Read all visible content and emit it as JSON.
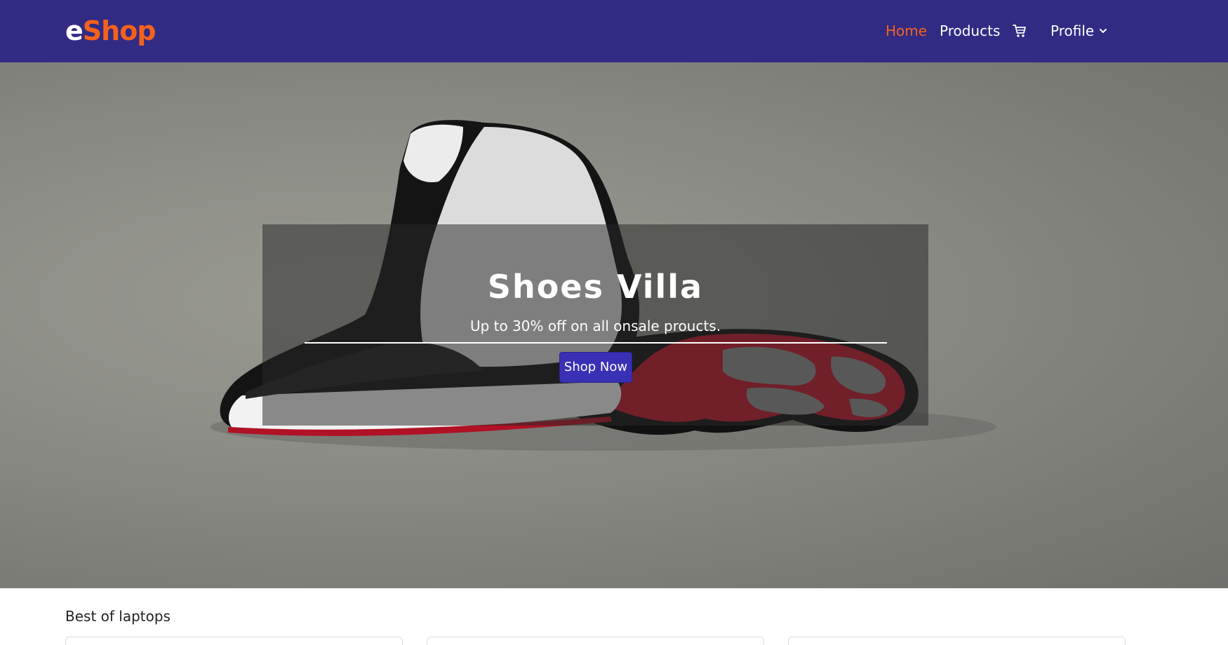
{
  "navbar": {
    "brand_first": "e",
    "brand_second": "Shop",
    "links": {
      "home": "Home",
      "products": "Products",
      "profile": "Profile"
    },
    "icons": {
      "cart": "cart-icon",
      "profile_dropdown": "chevron-down-icon"
    },
    "colors": {
      "background": "#322b84",
      "accent": "#f3621c"
    }
  },
  "hero": {
    "title": "Shoes Villa",
    "subtitle": "Up to 30% off on all onsale proucts.",
    "button_label": "Shop Now",
    "colors": {
      "button": "#3a30b6"
    }
  },
  "section": {
    "title": "Best of laptops",
    "card_count": 3
  }
}
